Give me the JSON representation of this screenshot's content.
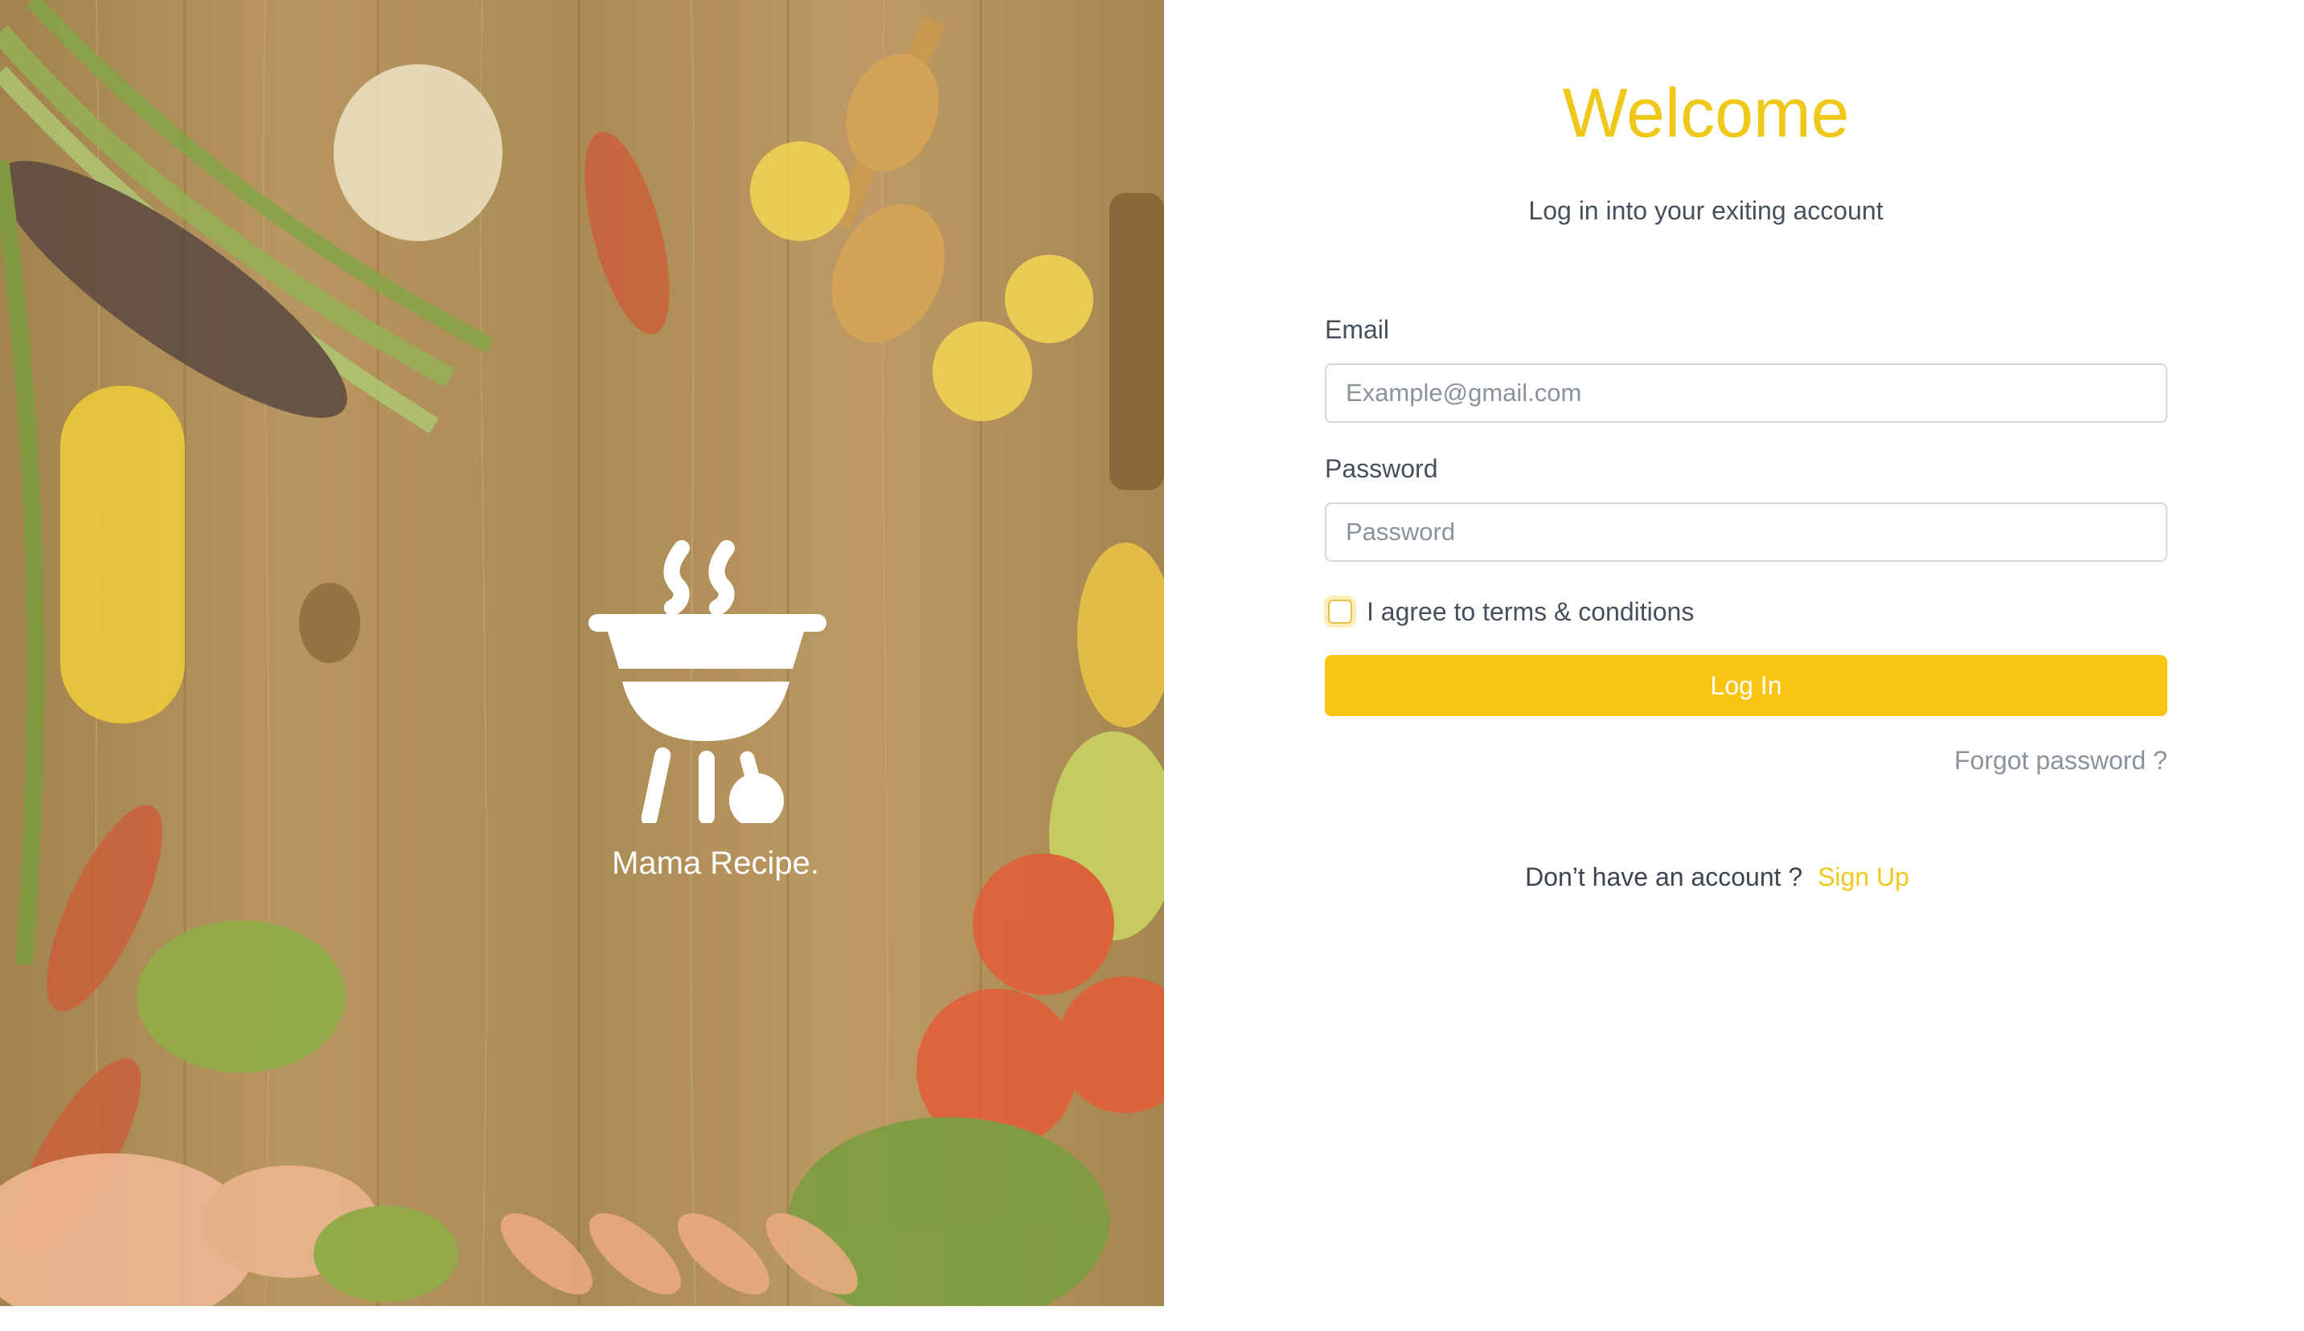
{
  "brand": {
    "name": "Mama Recipe."
  },
  "login": {
    "title": "Welcome",
    "subtitle": "Log in into your exiting account",
    "email_label": "Email",
    "email_placeholder": "Example@gmail.com",
    "password_label": "Password",
    "password_placeholder": "Password",
    "terms_label": "I agree to terms & conditions",
    "submit_label": "Log In",
    "forgot_label": "Forgot password ?",
    "no_account_text": "Don’t have an account ?",
    "signup_label": "Sign Up"
  },
  "colors": {
    "accent": "#fac412",
    "title": "#efc81a",
    "text": "#46505c",
    "muted": "#8a929c",
    "input_border": "#d5d8dc"
  },
  "icons": {
    "logo": "barbecue-grill-icon"
  }
}
